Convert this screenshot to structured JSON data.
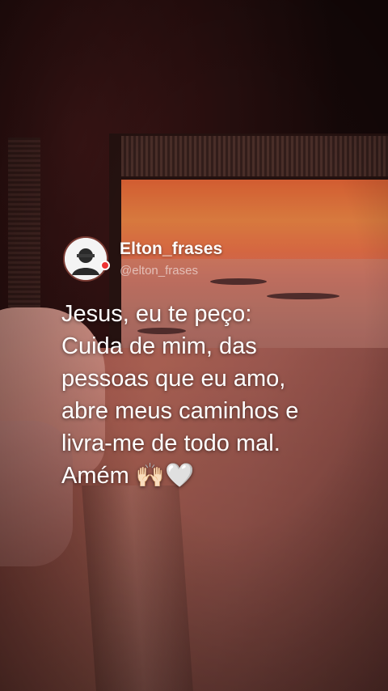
{
  "profile": {
    "display_name": "Elton_frases",
    "handle": "@elton_frases"
  },
  "quote": {
    "lines": [
      "Jesus, eu te peço:",
      "Cuida de mim, das",
      "pessoas que eu amo,",
      "abre meus caminhos e",
      "livra-me de todo mal.",
      "Amém 🙌🏻🤍"
    ]
  },
  "colors": {
    "sunset_sky": "#f58a47",
    "bed_sheet": "#c06d5e",
    "text": "#ffffff",
    "verified_dot": "#ee3333"
  },
  "icons": [
    "avatar-placeholder-icon",
    "verified-badge-icon"
  ]
}
